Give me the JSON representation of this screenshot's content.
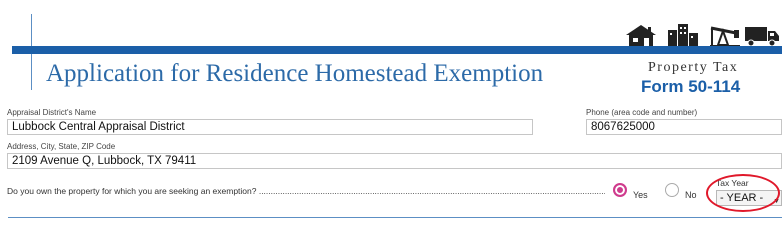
{
  "header": {
    "title": "Application for Residence Homestead Exemption",
    "category": "Property Tax",
    "form_number": "Form 50-114",
    "icons": [
      "house-icon",
      "buildings-icon",
      "oil-pump-icon",
      "truck-icon"
    ]
  },
  "fields": {
    "appraisal_district": {
      "label": "Appraisal District's Name",
      "value": "Lubbock Central Appraisal District"
    },
    "phone": {
      "label": "Phone (area code and number)",
      "value": "8067625000"
    },
    "address": {
      "label": "Address, City, State, ZIP Code",
      "value": "2109 Avenue Q, Lubbock, TX 79411"
    }
  },
  "ownership": {
    "question": "Do you own the property for which you are seeking an exemption? ..................................................................................................................................................................",
    "options": [
      {
        "label": "Yes",
        "selected": true
      },
      {
        "label": "No",
        "selected": false
      }
    ]
  },
  "tax_year": {
    "label": "Tax Year",
    "selected": "- YEAR -"
  },
  "colors": {
    "brand_blue": "#1b5fa8",
    "title_blue": "#2c6aa8",
    "radio_selected": "#cf3b8d",
    "highlight_red": "#e0182a"
  }
}
